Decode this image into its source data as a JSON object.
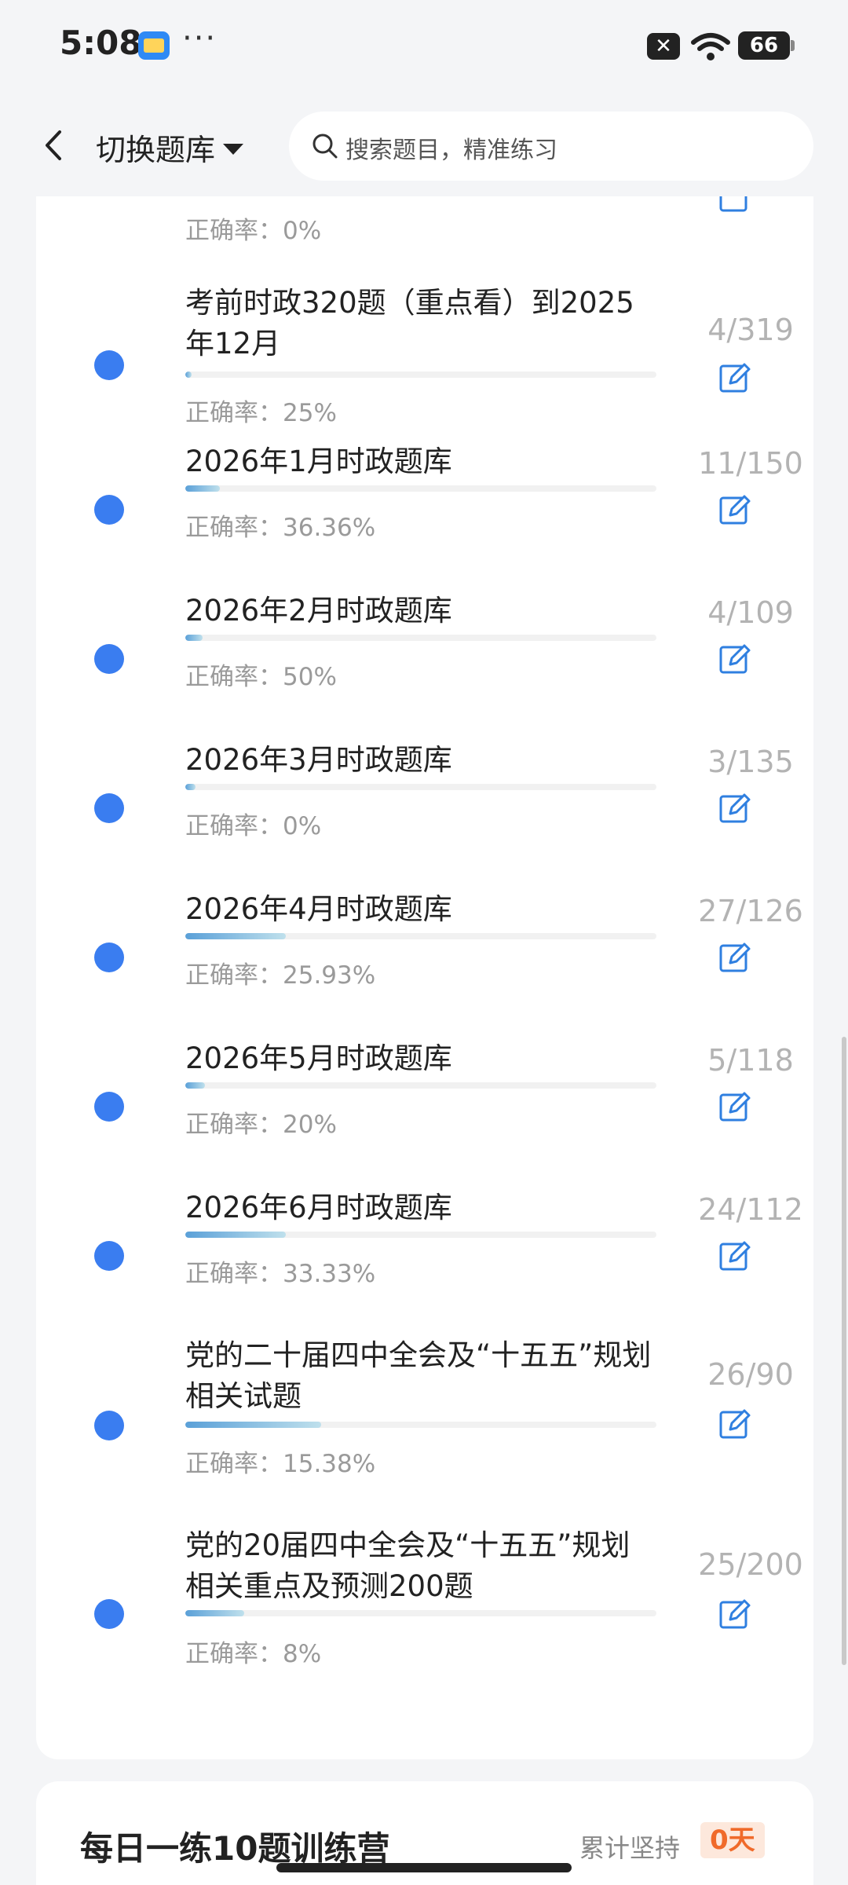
{
  "status_bar": {
    "time": "5:08",
    "dots": "···",
    "battery": "66",
    "mute": "✕"
  },
  "header": {
    "switch_label": "切换题库",
    "search_placeholder": "搜索题目，精准练习"
  },
  "partial_item": {
    "accuracy": "正确率：0%"
  },
  "items": [
    {
      "title": "考前时政320题（重点看）到2025年12月",
      "count": "4/319",
      "accuracy": "正确率：25%",
      "progress": 0.0125
    },
    {
      "title": "2026年1月时政题库",
      "count": "11/150",
      "accuracy": "正确率：36.36%",
      "progress": 0.073
    },
    {
      "title": "2026年2月时政题库",
      "count": "4/109",
      "accuracy": "正确率：50%",
      "progress": 0.037
    },
    {
      "title": "2026年3月时政题库",
      "count": "3/135",
      "accuracy": "正确率：0%",
      "progress": 0.022
    },
    {
      "title": "2026年4月时政题库",
      "count": "27/126",
      "accuracy": "正确率：25.93%",
      "progress": 0.214
    },
    {
      "title": "2026年5月时政题库",
      "count": "5/118",
      "accuracy": "正确率：20%",
      "progress": 0.042
    },
    {
      "title": "2026年6月时政题库",
      "count": "24/112",
      "accuracy": "正确率：33.33%",
      "progress": 0.214
    },
    {
      "title": "党的二十届四中全会及“十五五”规划相关试题",
      "count": "26/90",
      "accuracy": "正确率：15.38%",
      "progress": 0.289
    },
    {
      "title": "党的20届四中全会及“十五五”规划相关重点及预测200题",
      "count": "25/200",
      "accuracy": "正确率：8%",
      "progress": 0.125
    }
  ],
  "bottom_card": {
    "title": "每日一练10题训练营",
    "streak_label": "累计坚持",
    "days": "0天"
  }
}
